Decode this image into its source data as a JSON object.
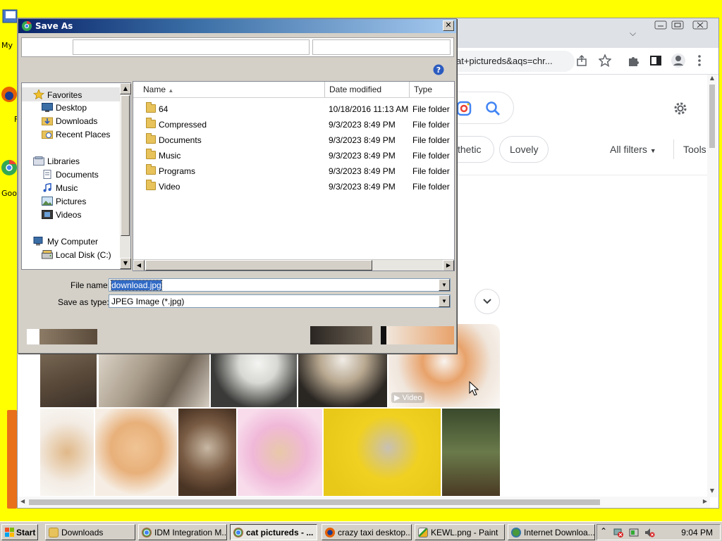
{
  "desktop": {
    "icons": [
      {
        "label": "My"
      },
      {
        "label": "F"
      },
      {
        "label": "Goog"
      }
    ]
  },
  "browser": {
    "address_text": "at+pictureds&aqs=chr...",
    "chips": [
      "thetic",
      "Lovely"
    ],
    "all_filters": "All filters",
    "tools": "Tools",
    "video_badge": "Video"
  },
  "dialog": {
    "title": "Save As",
    "nav": {
      "favorites": "Favorites",
      "desktop": "Desktop",
      "downloads": "Downloads",
      "recent_places": "Recent Places",
      "libraries": "Libraries",
      "documents": "Documents",
      "music": "Music",
      "pictures": "Pictures",
      "videos": "Videos",
      "my_computer": "My Computer",
      "local_disk": "Local Disk (C:)"
    },
    "columns": {
      "name": "Name",
      "date": "Date modified",
      "type": "Type"
    },
    "files": [
      {
        "name": "64",
        "date": "10/18/2016 11:13 AM",
        "type": "File folder"
      },
      {
        "name": "Compressed",
        "date": "9/3/2023 8:49 PM",
        "type": "File folder"
      },
      {
        "name": "Documents",
        "date": "9/3/2023 8:49 PM",
        "type": "File folder"
      },
      {
        "name": "Music",
        "date": "9/3/2023 8:49 PM",
        "type": "File folder"
      },
      {
        "name": "Programs",
        "date": "9/3/2023 8:49 PM",
        "type": "File folder"
      },
      {
        "name": "Video",
        "date": "9/3/2023 8:49 PM",
        "type": "File folder"
      }
    ],
    "file_name_label": "File name:",
    "file_name_value": "download.jpg",
    "save_type_label": "Save as type:",
    "save_type_value": "JPEG Image (*.jpg)"
  },
  "taskbar": {
    "start": "Start",
    "items": [
      {
        "label": "Downloads",
        "active": false
      },
      {
        "label": "IDM Integration M...",
        "active": false
      },
      {
        "label": "cat pictureds - ...",
        "active": true
      },
      {
        "label": "crazy taxi desktop...",
        "active": false
      },
      {
        "label": "KEWL.png - Paint",
        "active": false
      },
      {
        "label": "Internet Downloa...",
        "active": false
      }
    ],
    "clock": "9:04 PM"
  }
}
